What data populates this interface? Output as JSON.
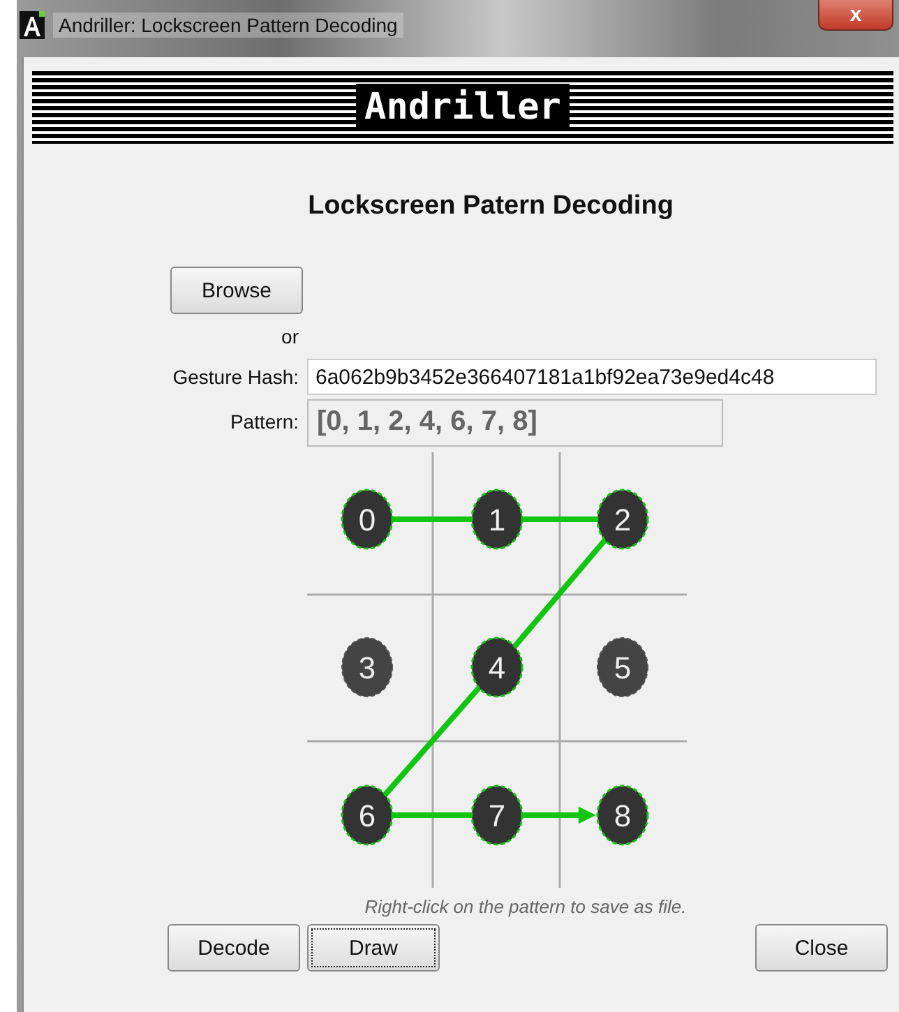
{
  "window": {
    "title": "Andriller: Lockscreen Pattern Decoding",
    "close_label": "x"
  },
  "banner": {
    "text": "Andriller"
  },
  "heading": "Lockscreen Patern Decoding",
  "browse_button": "Browse",
  "or_text": "or",
  "gesture_hash": {
    "label": "Gesture Hash:",
    "value": "6a062b9b3452e366407181a1bf92ea73e9ed4c48"
  },
  "pattern": {
    "label": "Pattern:",
    "value": "[0, 1, 2, 4, 6, 7, 8]"
  },
  "grid": {
    "dots": [
      {
        "label": "0",
        "selected": true
      },
      {
        "label": "1",
        "selected": true
      },
      {
        "label": "2",
        "selected": true
      },
      {
        "label": "3",
        "selected": false
      },
      {
        "label": "4",
        "selected": true
      },
      {
        "label": "5",
        "selected": false
      },
      {
        "label": "6",
        "selected": true
      },
      {
        "label": "7",
        "selected": true
      },
      {
        "label": "8",
        "selected": true
      }
    ]
  },
  "hint": "Right-click on the pattern to save as file.",
  "buttons": [
    {
      "label": "Decode",
      "focused": false
    },
    {
      "label": "Draw",
      "focused": true
    },
    {
      "label": "Close",
      "focused": false
    }
  ]
}
